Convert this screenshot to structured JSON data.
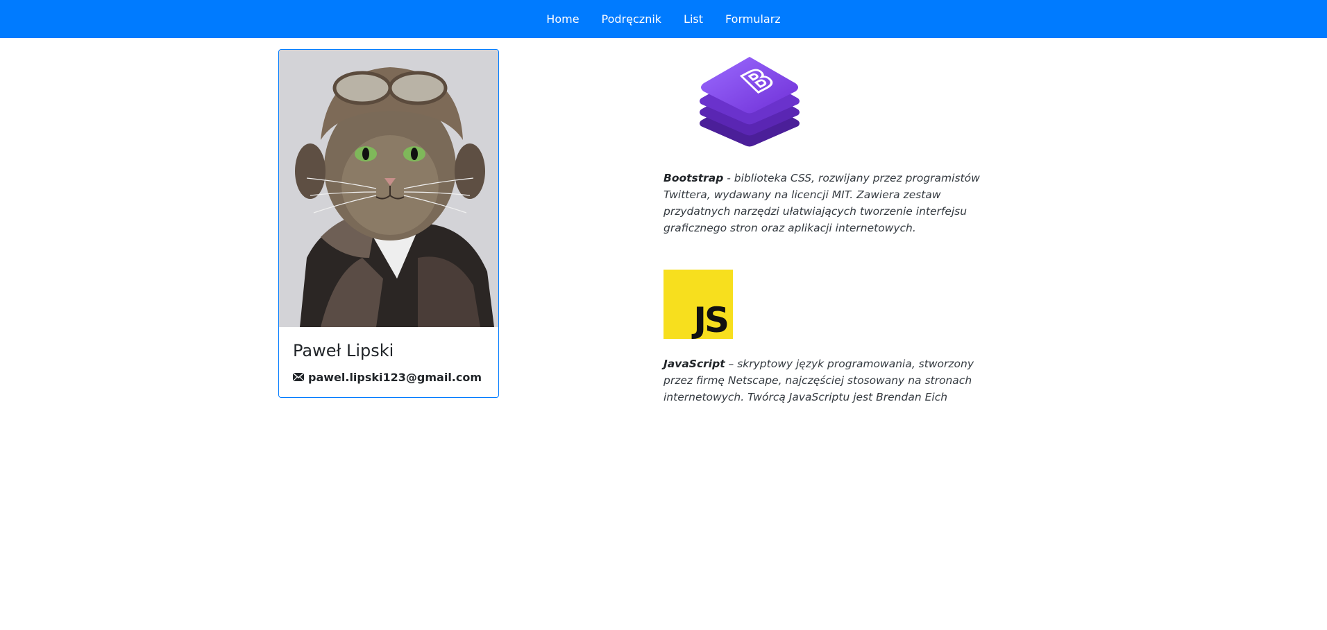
{
  "nav": {
    "items": [
      {
        "label": "Home"
      },
      {
        "label": "Podręcznik"
      },
      {
        "label": "List"
      },
      {
        "label": "Formularz"
      }
    ]
  },
  "profile": {
    "name": "Paweł Lipski",
    "email": "pawel.lipski123@gmail.com",
    "photo_icon": "cat-aviator-photo",
    "email_icon": "envelope-icon"
  },
  "tech": [
    {
      "term": "Bootstrap",
      "text": " - biblioteka CSS, rozwijany przez programistów Twittera, wydawany na licencji MIT. Zawiera zestaw przydatnych narzędzi ułatwiających tworzenie interfejsu graficznego stron oraz aplikacji internetowych.",
      "logo_icon": "bootstrap-logo"
    },
    {
      "term": "JavaScript",
      "text": " – skryptowy język programowania, stworzony przez firmę Netscape, najczęściej stosowany na stronach internetowych. Twórcą JavaScriptu jest Brendan Eich",
      "logo_text": "JS",
      "logo_icon": "javascript-logo"
    }
  ],
  "colors": {
    "navbar": "#007bff",
    "card_border": "#007bff",
    "bootstrap_purple": "#7952b3",
    "js_yellow": "#f7df1e"
  }
}
